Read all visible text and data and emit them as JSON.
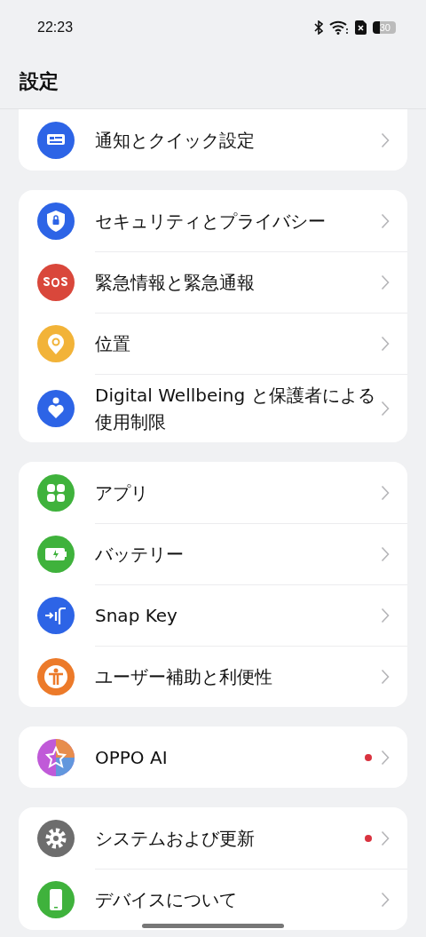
{
  "status_bar": {
    "time": "22:23",
    "battery": "30"
  },
  "header": {
    "title": "設定"
  },
  "groups": [
    {
      "items": [
        {
          "label": "通知とクイック設定",
          "color": "#2d64e6",
          "badge": false
        }
      ]
    },
    {
      "items": [
        {
          "label": "セキュリティとプライバシー",
          "color": "#2d64e6",
          "badge": false
        },
        {
          "label": "緊急情報と緊急通報",
          "color": "#d9473b",
          "badge": false
        },
        {
          "label": "位置",
          "color": "#f2b338",
          "badge": false
        },
        {
          "label": "Digital Wellbeing と保護者による使用制限",
          "color": "#2d64e6",
          "badge": false
        }
      ]
    },
    {
      "items": [
        {
          "label": "アプリ",
          "color": "#3fb23c",
          "badge": false
        },
        {
          "label": "バッテリー",
          "color": "#3fb23c",
          "badge": false
        },
        {
          "label": "Snap Key",
          "color": "#2d64e6",
          "badge": false
        },
        {
          "label": "ユーザー補助と利便性",
          "color": "#ec7a2a",
          "badge": false
        }
      ]
    },
    {
      "items": [
        {
          "label": "OPPO AI",
          "color": "#c05ad8",
          "badge": true
        }
      ]
    },
    {
      "items": [
        {
          "label": "システムおよび更新",
          "color": "#6d6d6d",
          "badge": true
        },
        {
          "label": "デバイスについて",
          "color": "#3fb23c",
          "badge": false
        }
      ]
    }
  ]
}
